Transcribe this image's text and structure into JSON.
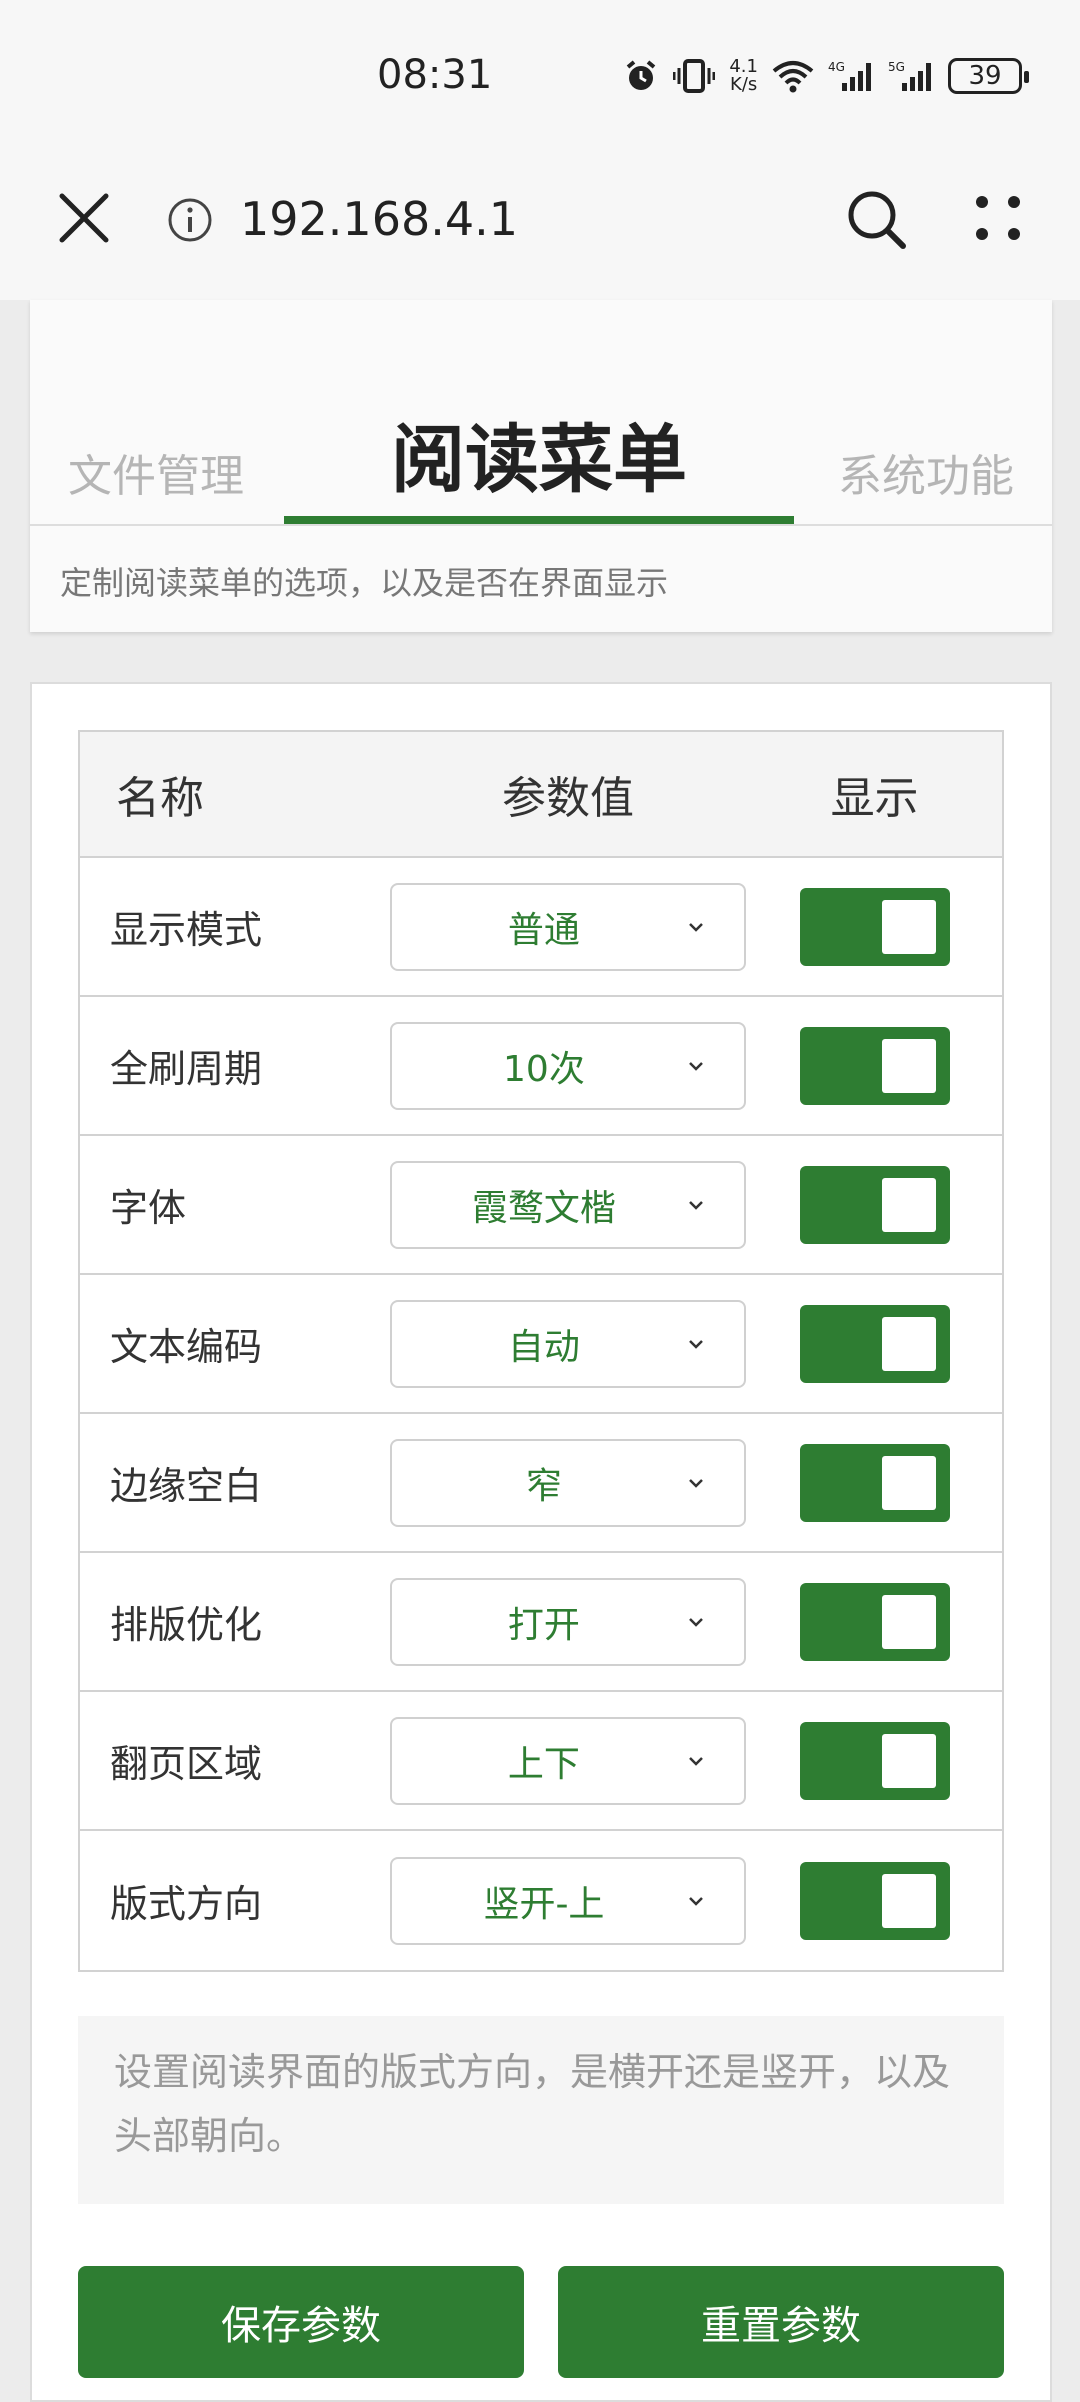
{
  "status": {
    "time": "08:31",
    "speed_top": "4.1",
    "speed_bottom": "K/s",
    "battery": "39"
  },
  "browser": {
    "url": "192.168.4.1",
    "icons": [
      "close-icon",
      "info-icon",
      "search-icon",
      "more-icon"
    ]
  },
  "tabs": {
    "left": "文件管理",
    "active": "阅读菜单",
    "right": "系统功能",
    "description": "定制阅读菜单的选项，以及是否在界面显示"
  },
  "table": {
    "headers": {
      "name": "名称",
      "value": "参数值",
      "show": "显示"
    },
    "rows": [
      {
        "name": "显示模式",
        "value": "普通",
        "show": true
      },
      {
        "name": "全刷周期",
        "value": "10次",
        "show": true
      },
      {
        "name": "字体",
        "value": "霞鹜文楷",
        "show": true
      },
      {
        "name": "文本编码",
        "value": "自动",
        "show": true
      },
      {
        "name": "边缘空白",
        "value": "窄",
        "show": true
      },
      {
        "name": "排版优化",
        "value": "打开",
        "show": true
      },
      {
        "name": "翻页区域",
        "value": "上下",
        "show": true
      },
      {
        "name": "版式方向",
        "value": "竖开-上",
        "show": true
      }
    ]
  },
  "hint": "设置阅读界面的版式方向，是横开还是竖开，以及头部朝向。",
  "buttons": {
    "save": "保存参数",
    "reset": "重置参数"
  },
  "colors": {
    "accent": "#2e7d32"
  }
}
